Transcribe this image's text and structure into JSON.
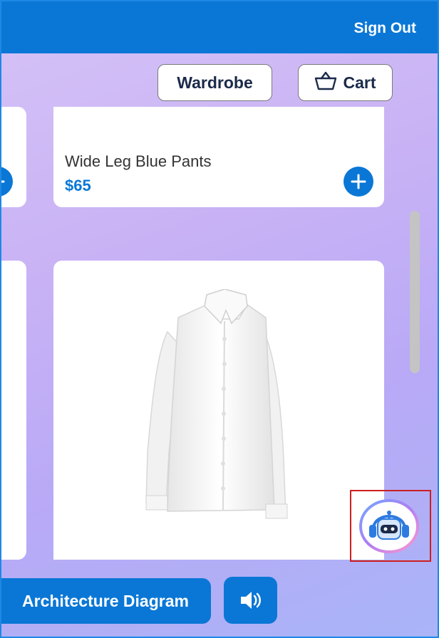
{
  "header": {
    "sign_out_label": "Sign Out"
  },
  "toolbar": {
    "wardrobe_label": "Wardrobe",
    "cart_label": "Cart"
  },
  "products": [
    {
      "name": "Wide Leg Blue Pants",
      "price": "$65"
    },
    {
      "name": "",
      "price": ""
    }
  ],
  "footer": {
    "architecture_label": "Architecture Diagram"
  },
  "icons": {
    "cart": "basket-icon",
    "add": "plus-icon",
    "assistant": "robot-icon",
    "sound": "speaker-icon"
  },
  "colors": {
    "primary": "#0a77d6",
    "highlight": "#cc1f1f"
  }
}
